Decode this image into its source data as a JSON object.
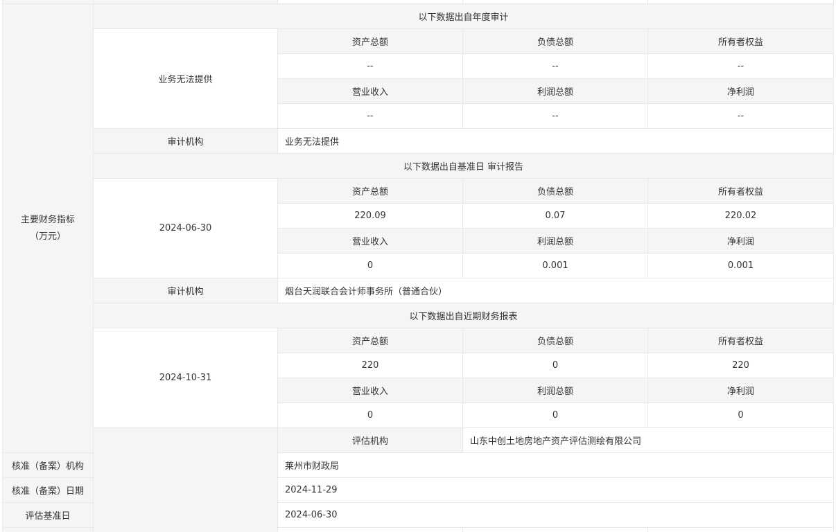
{
  "section_label_line1": "主要财务指标",
  "section_label_line2": "（万元）",
  "blocks": [
    {
      "header": "以下数据出自年度审计",
      "date": "业务无法提供",
      "headers1": [
        "资产总额",
        "负债总额",
        "所有者权益"
      ],
      "values1": [
        "--",
        "--",
        "--"
      ],
      "headers2": [
        "营业收入",
        "利润总额",
        "净利润"
      ],
      "values2": [
        "--",
        "--",
        "--"
      ],
      "audit_label": "审计机构",
      "audit_value": "业务无法提供"
    },
    {
      "header": "以下数据出自基准日 审计报告",
      "date": "2024-06-30",
      "headers1": [
        "资产总额",
        "负债总额",
        "所有者权益"
      ],
      "values1": [
        "220.09",
        "0.07",
        "220.02"
      ],
      "headers2": [
        "营业收入",
        "利润总额",
        "净利润"
      ],
      "values2": [
        "0",
        "0.001",
        "0.001"
      ],
      "audit_label": "审计机构",
      "audit_value": "烟台天润联合会计师事务所（普通合伙）"
    },
    {
      "header": "以下数据出自近期财务报表",
      "date": "2024-10-31",
      "headers1": [
        "资产总额",
        "负债总额",
        "所有者权益"
      ],
      "values1": [
        "220",
        "0",
        "220"
      ],
      "headers2": [
        "营业收入",
        "利润总额",
        "净利润"
      ],
      "values2": [
        "0",
        "0",
        "0"
      ]
    }
  ],
  "eval_rows": [
    {
      "label": "评估机构",
      "value": "山东中创土地房地产资产评估测绘有限公司"
    },
    {
      "label": "核准（备案）机构",
      "value": "莱州市财政局"
    },
    {
      "label": "核准（备案）日期",
      "value": "2024-11-29"
    },
    {
      "label": "评估基准日",
      "value": "2024-06-30"
    }
  ]
}
